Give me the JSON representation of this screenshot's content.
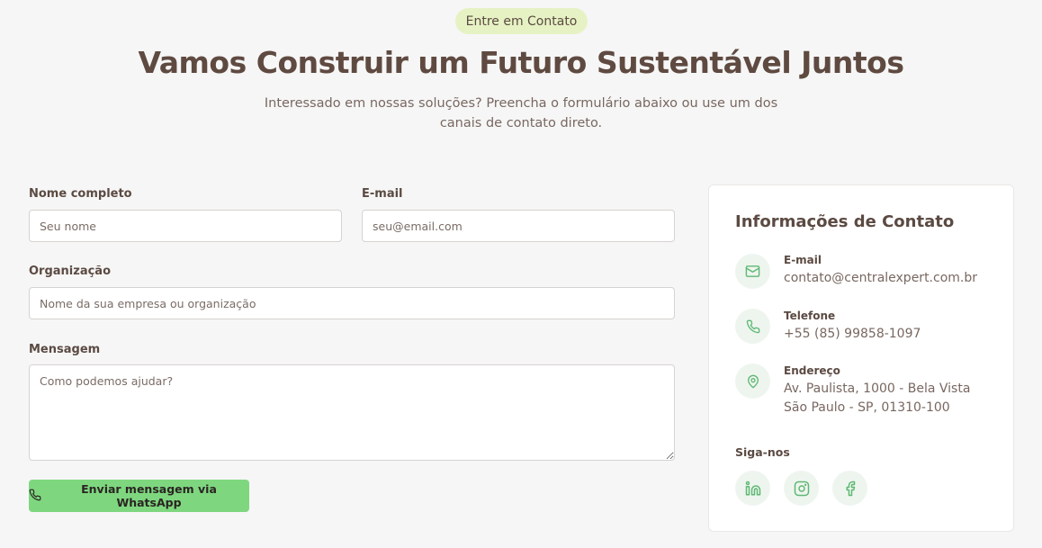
{
  "header": {
    "badge": "Entre em Contato",
    "title": "Vamos Construir um Futuro Sustentável Juntos",
    "subtitle": "Interessado em nossas soluções? Preencha o formulário abaixo ou use um dos canais de contato direto."
  },
  "form": {
    "name_label": "Nome completo",
    "name_placeholder": "Seu nome",
    "email_label": "E-mail",
    "email_placeholder": "seu@email.com",
    "org_label": "Organização",
    "org_placeholder": "Nome da sua empresa ou organização",
    "message_label": "Mensagem",
    "message_placeholder": "Como podemos ajudar?",
    "submit_label": "Enviar mensagem via WhatsApp"
  },
  "contact": {
    "title": "Informações de Contato",
    "email_label": "E-mail",
    "email_value": "contato@centralexpert.com.br",
    "phone_label": "Telefone",
    "phone_value": "+55 (85) 99858-1097",
    "address_label": "Endereço",
    "address_line1": "Av. Paulista, 1000 - Bela Vista",
    "address_line2": "São Paulo - SP, 01310-100",
    "follow_label": "Siga-nos",
    "social": [
      "linkedin-icon",
      "instagram-icon",
      "facebook-icon"
    ]
  },
  "colors": {
    "accent": "#7ed77f",
    "icon_green": "#5fb873",
    "badge_bg": "#e6f2c4",
    "text": "#5b4a42"
  }
}
